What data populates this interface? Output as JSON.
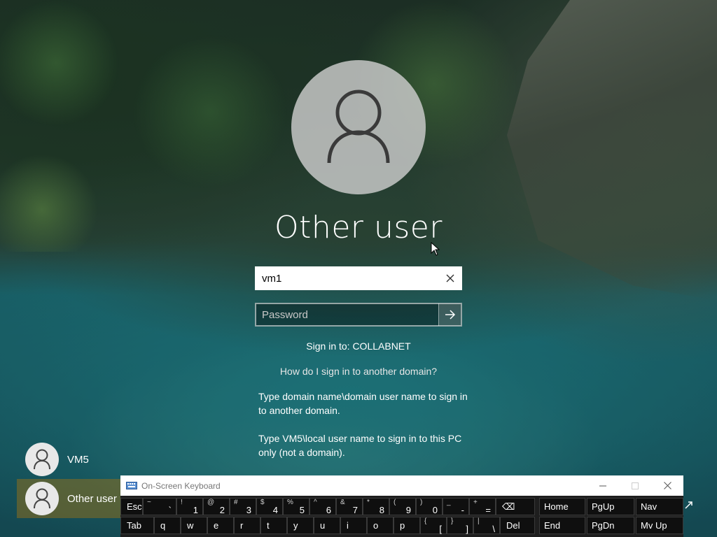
{
  "login": {
    "title": "Other user",
    "username_value": "vm1",
    "password_placeholder": "Password",
    "signin_to": "Sign in to: COLLABNET",
    "help_link": "How do I sign in to another domain?",
    "help_text_1": "Type domain name\\domain user name to sign in to another domain.",
    "help_text_2": "Type VM5\\local user name to sign in to this PC only (not a domain)."
  },
  "users": [
    {
      "label": "VM5"
    },
    {
      "label": "Other user"
    }
  ],
  "osk": {
    "title": "On-Screen Keyboard",
    "row1": [
      {
        "main": "Esc",
        "shift": ""
      },
      {
        "main": "`",
        "shift": "~"
      },
      {
        "main": "1",
        "shift": "!"
      },
      {
        "main": "2",
        "shift": "@"
      },
      {
        "main": "3",
        "shift": "#"
      },
      {
        "main": "4",
        "shift": "$"
      },
      {
        "main": "5",
        "shift": "%"
      },
      {
        "main": "6",
        "shift": "^"
      },
      {
        "main": "7",
        "shift": "&"
      },
      {
        "main": "8",
        "shift": "*"
      },
      {
        "main": "9",
        "shift": "("
      },
      {
        "main": "0",
        "shift": ")"
      },
      {
        "main": "-",
        "shift": "_"
      },
      {
        "main": "=",
        "shift": "+"
      },
      {
        "main": "⌫",
        "shift": ""
      }
    ],
    "row2": [
      {
        "main": "Tab",
        "shift": ""
      },
      {
        "main": "q",
        "shift": ""
      },
      {
        "main": "w",
        "shift": ""
      },
      {
        "main": "e",
        "shift": ""
      },
      {
        "main": "r",
        "shift": ""
      },
      {
        "main": "t",
        "shift": ""
      },
      {
        "main": "y",
        "shift": ""
      },
      {
        "main": "u",
        "shift": ""
      },
      {
        "main": "i",
        "shift": ""
      },
      {
        "main": "o",
        "shift": ""
      },
      {
        "main": "p",
        "shift": ""
      },
      {
        "main": "[",
        "shift": "{"
      },
      {
        "main": "]",
        "shift": "}"
      },
      {
        "main": "\\",
        "shift": "|"
      },
      {
        "main": "Del",
        "shift": ""
      }
    ],
    "nav_row1": [
      "Home",
      "PgUp",
      "Nav"
    ],
    "nav_row2": [
      "End",
      "PgDn",
      "Mv Up"
    ]
  }
}
